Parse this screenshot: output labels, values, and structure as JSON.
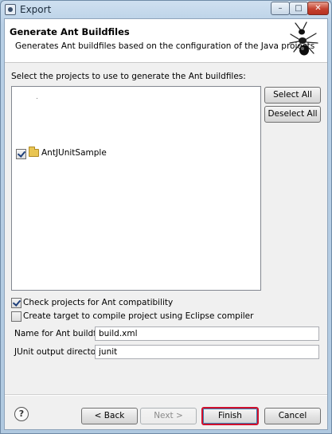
{
  "window": {
    "title": "Export"
  },
  "header": {
    "title": "Generate Ant Buildfiles",
    "description": "Generates Ant buildfiles based on the configuration of the Java projects",
    "icon": "ant-icon"
  },
  "projects": {
    "prompt": "Select the projects to use to generate the Ant buildfiles:",
    "items": [
      {
        "label": "AntJUnitSample",
        "checked": true,
        "icon": "folder-icon"
      }
    ],
    "select_all_label": "Select All",
    "deselect_all_label": "Deselect All"
  },
  "options": {
    "check_compat_label": "Check projects for Ant compatibility",
    "check_compat_checked": true,
    "eclipse_compiler_label": "Create target to compile project using Eclipse compiler",
    "eclipse_compiler_checked": false
  },
  "fields": {
    "buildfile_label": "Name for Ant buildfile:",
    "buildfile_value": "build.xml",
    "junit_label": "JUnit output directory:",
    "junit_value": "junit"
  },
  "footer": {
    "help_glyph": "?",
    "back_label": "< Back",
    "next_label": "Next >",
    "finish_label": "Finish",
    "cancel_label": "Cancel"
  },
  "colors": {
    "highlight": "#d0102c"
  }
}
